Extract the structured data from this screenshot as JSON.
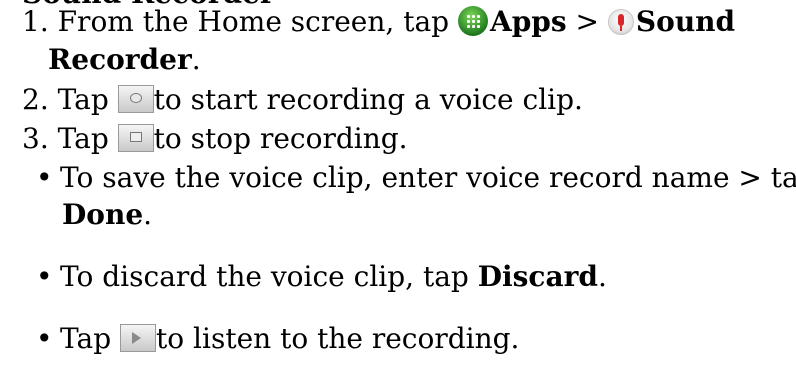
{
  "heading_fragment": "Sound Recorder",
  "steps": [
    {
      "num": "1.",
      "pre": "From the Home screen, tap",
      "icon1_name": "apps-icon",
      "apps_label": "Apps",
      "sep": " >",
      "icon2_name": "microphone-icon",
      "sound_label": "Sound",
      "recorder_label": "Recorder",
      "end": "."
    },
    {
      "num": "2.",
      "pre": "Tap",
      "icon_name": "record-button-icon",
      "post": "to start recording a voice clip."
    },
    {
      "num": "3.",
      "pre": "Tap",
      "icon_name": "stop-button-icon",
      "post": "to stop recording."
    }
  ],
  "bullets": [
    {
      "text": "To save the voice clip, enter voice record name > tap",
      "bold": "Done",
      "end": "."
    },
    {
      "text": "To discard the voice clip, tap",
      "bold": "Discard",
      "end": "."
    },
    {
      "pre": "Tap",
      "icon_name": "play-button-icon",
      "post": "to listen to the recording."
    }
  ]
}
